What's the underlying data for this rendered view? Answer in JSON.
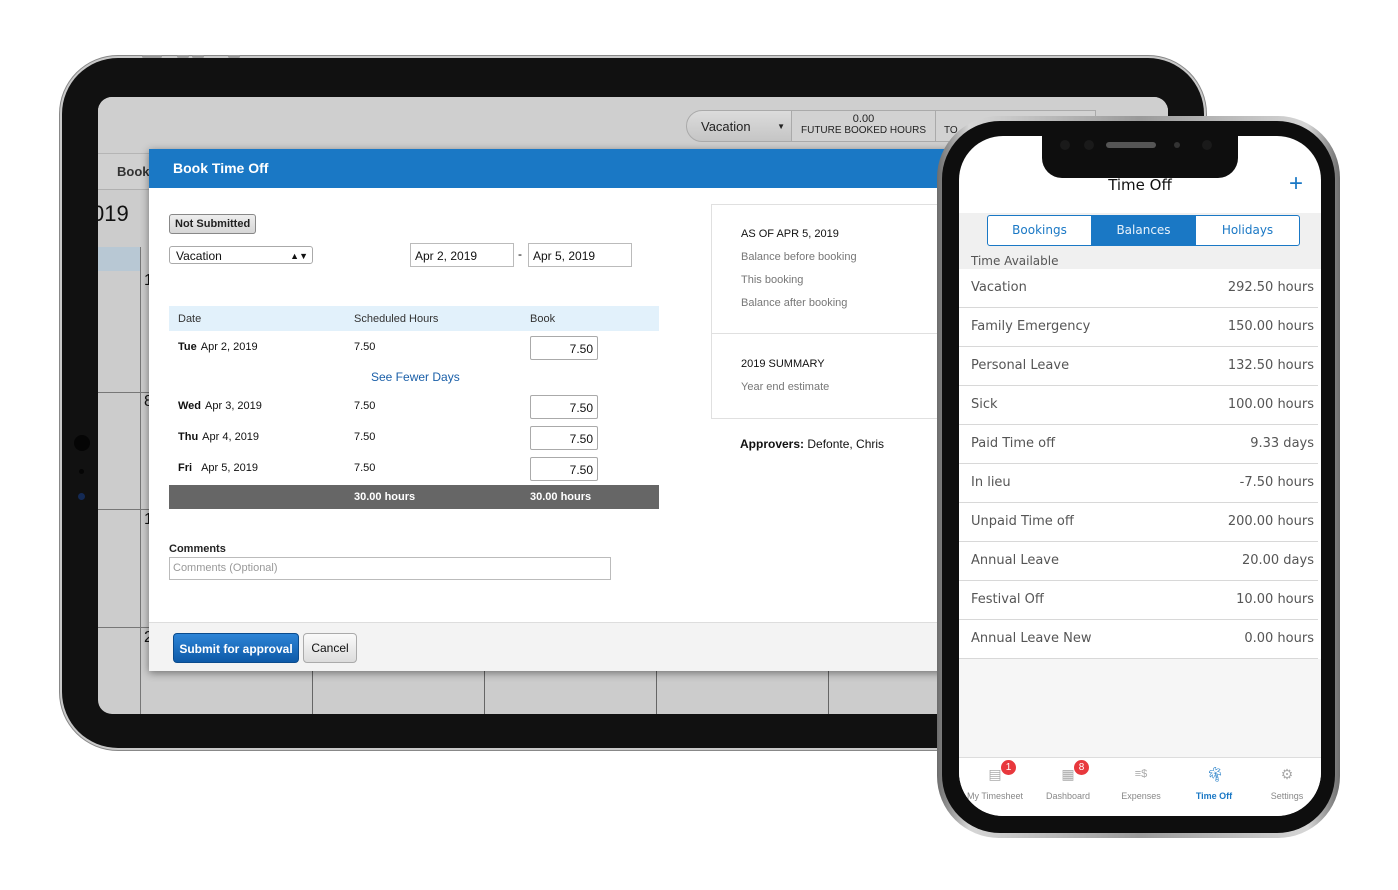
{
  "tablet": {
    "top_bar": {
      "leave_type_selector": "Vacation",
      "future_booked_value": "0.00",
      "future_booked_label": "FUTURE BOOKED HOURS",
      "next_stat_label_partial": "TO"
    },
    "toolbar_partial_label": "Book",
    "calendar_year_partial": "019",
    "calendar_day_numbers_partial": [
      "1",
      "8",
      "1",
      "2"
    ],
    "modal": {
      "title": "Book Time Off",
      "status_badge": "Not Submitted",
      "leave_type": "Vacation",
      "start_date": "Apr 2, 2019",
      "date_separator": "-",
      "end_date": "Apr 5, 2019",
      "table": {
        "headers": [
          "Date",
          "Scheduled Hours",
          "Book"
        ],
        "rows": [
          {
            "day": "Tue",
            "date": "Apr 2, 2019",
            "scheduled": "7.50",
            "book": "7.50"
          },
          {
            "day": "Wed",
            "date": "Apr 3, 2019",
            "scheduled": "7.50",
            "book": "7.50"
          },
          {
            "day": "Thu",
            "date": "Apr 4, 2019",
            "scheduled": "7.50",
            "book": "7.50"
          },
          {
            "day": "Fri",
            "date": "Apr 5, 2019",
            "scheduled": "7.50",
            "book": "7.50"
          }
        ],
        "see_fewer_link": "See Fewer Days",
        "total_scheduled": "30.00 hours",
        "total_book": "30.00 hours"
      },
      "comments_label": "Comments",
      "comments_placeholder": "Comments (Optional)",
      "summary": {
        "as_of_title": "AS OF APR 5, 2019",
        "balance_before": "Balance before booking",
        "this_booking": "This booking",
        "balance_after": "Balance after booking",
        "year_summary_title": "2019 SUMMARY",
        "year_end_estimate": "Year end estimate"
      },
      "approvers_label": "Approvers:",
      "approvers_value": "Defonte, Chris",
      "submit_button": "Submit for approval",
      "cancel_button": "Cancel"
    }
  },
  "phone": {
    "title": "Time Off",
    "add_icon": "plus-icon",
    "segments": [
      {
        "label": "Bookings",
        "active": false
      },
      {
        "label": "Balances",
        "active": true
      },
      {
        "label": "Holidays",
        "active": false
      }
    ],
    "section_label": "Time Available",
    "balances": [
      {
        "name": "Vacation",
        "value": "292.50 hours"
      },
      {
        "name": "Family Emergency",
        "value": "150.00 hours"
      },
      {
        "name": "Personal Leave",
        "value": "132.50 hours"
      },
      {
        "name": "Sick",
        "value": "100.00 hours"
      },
      {
        "name": "Paid Time off",
        "value": "9.33 days"
      },
      {
        "name": "In lieu",
        "value": "-7.50 hours"
      },
      {
        "name": "Unpaid Time off",
        "value": "200.00 hours"
      },
      {
        "name": "Annual Leave",
        "value": "20.00 days"
      },
      {
        "name": "Festival Off",
        "value": "10.00 hours"
      },
      {
        "name": "Annual Leave New",
        "value": "0.00 hours"
      }
    ],
    "tabbar": [
      {
        "label": "My Timesheet",
        "icon": "timesheet-icon",
        "badge": "1",
        "active": false
      },
      {
        "label": "Dashboard",
        "icon": "dashboard-grid-icon",
        "badge": "8",
        "active": false
      },
      {
        "label": "Expenses",
        "icon": "expenses-icon",
        "badge": null,
        "active": false
      },
      {
        "label": "Time Off",
        "icon": "palm-tree-icon",
        "badge": null,
        "active": true
      },
      {
        "label": "Settings",
        "icon": "gear-icon",
        "badge": null,
        "active": false
      }
    ]
  },
  "colors": {
    "accent_blue": "#1a78c5",
    "badge_red": "#e8383d",
    "total_row_gray": "#666666",
    "table_header_bg": "#e2f1fb"
  }
}
